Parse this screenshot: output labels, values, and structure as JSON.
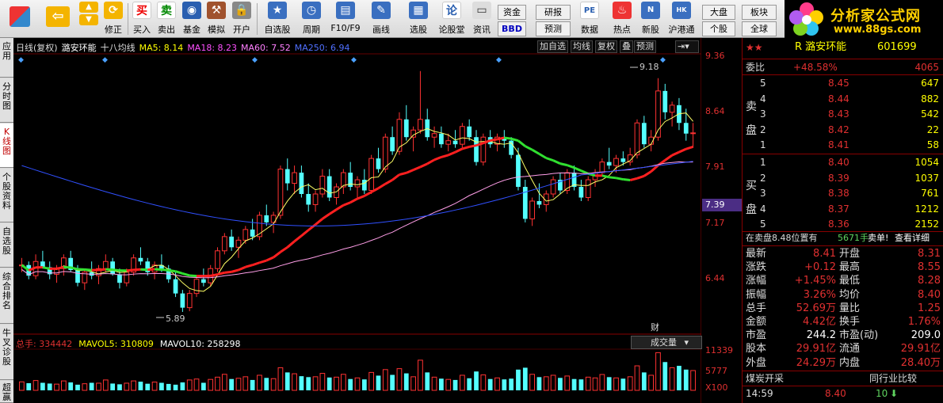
{
  "toolbar": {
    "buttons": [
      {
        "label": "买入",
        "icon": "buy-icon"
      },
      {
        "label": "卖出",
        "icon": "sell-icon"
      },
      {
        "label": "基金",
        "icon": "fund-icon"
      },
      {
        "label": "模拟",
        "icon": "hammer-icon"
      },
      {
        "label": "开户",
        "icon": "lock-icon"
      },
      {
        "label": "自选股",
        "icon": "star-icon"
      },
      {
        "label": "周期",
        "icon": "clock-icon"
      },
      {
        "label": "F10/F9",
        "icon": "f10-icon"
      },
      {
        "label": "画线",
        "icon": "pen-icon"
      },
      {
        "label": "选股",
        "icon": "screen-icon"
      },
      {
        "label": "论股堂",
        "icon": "forum-icon"
      },
      {
        "label": "资讯",
        "icon": "news-icon"
      },
      {
        "label": "数据",
        "icon": "pe-icon"
      },
      {
        "label": "热点",
        "icon": "hot-icon"
      },
      {
        "label": "新股",
        "icon": "newstock-icon"
      },
      {
        "label": "沪港通",
        "icon": "hk-icon"
      }
    ],
    "nav_prev": "修正",
    "small_buttons": {
      "fund": "资金",
      "bbd": "BBD",
      "research": "研报",
      "forecast": "预测",
      "market": "大盘",
      "stock": "个股",
      "sector": "板块",
      "global": "全球"
    }
  },
  "logo": {
    "title": "分析家公式网",
    "url": "www.88gs.com"
  },
  "left_tabs": [
    "应用",
    "分时图",
    "K线图",
    "个股资料",
    "自选股",
    "综合排名",
    "牛叉诊股",
    "超赢"
  ],
  "chart_header": {
    "period": "日线(复权)",
    "stock_name": "潞安环能",
    "indicator": "十八均线",
    "ma5": "MA5: 8.14",
    "ma18": "MA18: 8.23",
    "ma60": "MA60: 7.52",
    "ma250": "MA250: 6.94",
    "buttons": [
      "加自选",
      "均线",
      "复权",
      "叠",
      "预测"
    ]
  },
  "price_axis": [
    "9.36",
    "8.64",
    "7.91",
    "7.17",
    "6.44"
  ],
  "price_highlight": "7.39",
  "annotations": {
    "high": "9.18",
    "low": "5.89",
    "cai": "财"
  },
  "volume": {
    "header_total": "总手: 334442",
    "mavol5": "MAVOL5: 310809",
    "mavol10": "MAVOL10: 258298",
    "selector": "成交量",
    "axis": [
      "11339",
      "5777",
      "X100"
    ]
  },
  "chart_data": {
    "type": "candlestick",
    "ylim": [
      5.6,
      9.5
    ],
    "candles": [
      [
        6.55,
        6.65,
        6.45,
        6.55
      ],
      [
        6.55,
        6.6,
        6.35,
        6.4
      ],
      [
        6.4,
        6.7,
        6.35,
        6.6
      ],
      [
        6.6,
        6.75,
        6.5,
        6.52
      ],
      [
        6.52,
        6.6,
        6.35,
        6.42
      ],
      [
        6.42,
        6.55,
        6.3,
        6.5
      ],
      [
        6.5,
        6.7,
        6.4,
        6.65
      ],
      [
        6.65,
        6.75,
        6.45,
        6.48
      ],
      [
        6.48,
        6.55,
        6.25,
        6.3
      ],
      [
        6.3,
        6.5,
        6.2,
        6.45
      ],
      [
        6.45,
        6.6,
        6.35,
        6.4
      ],
      [
        6.4,
        6.55,
        6.28,
        6.5
      ],
      [
        6.5,
        6.7,
        6.45,
        6.6
      ],
      [
        6.6,
        6.65,
        6.4,
        6.42
      ],
      [
        6.42,
        6.5,
        6.22,
        6.3
      ],
      [
        6.3,
        6.5,
        6.25,
        6.45
      ],
      [
        6.45,
        6.7,
        6.4,
        6.65
      ],
      [
        6.65,
        6.8,
        6.55,
        6.6
      ],
      [
        6.6,
        6.65,
        6.4,
        6.45
      ],
      [
        6.45,
        6.6,
        6.35,
        6.55
      ],
      [
        6.55,
        6.7,
        6.45,
        6.5
      ],
      [
        6.5,
        6.55,
        6.3,
        6.35
      ],
      [
        6.35,
        6.45,
        6.1,
        6.15
      ],
      [
        6.15,
        6.2,
        5.89,
        5.95
      ],
      [
        5.95,
        6.2,
        5.9,
        6.15
      ],
      [
        6.15,
        6.4,
        6.1,
        6.35
      ],
      [
        6.35,
        6.5,
        6.25,
        6.3
      ],
      [
        6.3,
        6.55,
        6.25,
        6.5
      ],
      [
        6.5,
        6.8,
        6.45,
        6.75
      ],
      [
        6.75,
        7.0,
        6.7,
        6.95
      ],
      [
        6.95,
        7.05,
        6.75,
        6.8
      ],
      [
        6.8,
        6.95,
        6.65,
        6.9
      ],
      [
        6.9,
        7.1,
        6.85,
        7.05
      ],
      [
        7.05,
        7.2,
        6.9,
        6.95
      ],
      [
        6.95,
        7.3,
        6.9,
        7.25
      ],
      [
        7.25,
        7.4,
        7.1,
        7.15
      ],
      [
        7.15,
        7.3,
        7.0,
        7.25
      ],
      [
        7.25,
        7.95,
        7.2,
        7.9
      ],
      [
        7.9,
        8.05,
        7.6,
        7.7
      ],
      [
        7.7,
        7.95,
        7.55,
        7.85
      ],
      [
        7.85,
        7.95,
        7.5,
        7.55
      ],
      [
        7.55,
        7.7,
        7.3,
        7.4
      ],
      [
        7.4,
        7.6,
        7.3,
        7.55
      ],
      [
        7.55,
        7.9,
        7.5,
        7.8
      ],
      [
        7.8,
        7.9,
        7.45,
        7.5
      ],
      [
        7.5,
        7.7,
        7.4,
        7.65
      ],
      [
        7.65,
        7.9,
        7.55,
        7.85
      ],
      [
        7.85,
        8.0,
        7.6,
        7.65
      ],
      [
        7.65,
        7.8,
        7.5,
        7.75
      ],
      [
        7.75,
        7.9,
        7.55,
        7.6
      ],
      [
        7.6,
        8.1,
        7.55,
        8.05
      ],
      [
        8.05,
        8.2,
        7.85,
        7.9
      ],
      [
        7.9,
        8.4,
        7.85,
        8.35
      ],
      [
        8.35,
        8.5,
        8.1,
        8.15
      ],
      [
        8.15,
        8.7,
        8.1,
        8.6
      ],
      [
        8.6,
        8.8,
        8.3,
        8.35
      ],
      [
        8.35,
        8.5,
        8.15,
        8.45
      ],
      [
        8.45,
        9.28,
        8.4,
        8.6
      ],
      [
        8.6,
        8.75,
        8.3,
        8.35
      ],
      [
        8.35,
        8.5,
        8.2,
        8.4
      ],
      [
        8.4,
        8.5,
        8.2,
        8.25
      ],
      [
        8.25,
        8.4,
        8.15,
        8.3
      ],
      [
        8.3,
        8.45,
        8.2,
        8.25
      ],
      [
        8.25,
        8.55,
        8.2,
        8.5
      ],
      [
        8.5,
        8.6,
        8.3,
        8.35
      ],
      [
        8.35,
        8.45,
        7.95,
        8.0
      ],
      [
        8.0,
        8.4,
        7.95,
        8.35
      ],
      [
        8.35,
        8.45,
        8.2,
        8.25
      ],
      [
        8.25,
        8.4,
        8.15,
        8.35
      ],
      [
        8.35,
        8.45,
        8.2,
        8.3
      ],
      [
        8.3,
        8.35,
        8.05,
        8.1
      ],
      [
        8.1,
        8.2,
        7.6,
        7.65
      ],
      [
        7.65,
        7.75,
        7.15,
        7.2
      ],
      [
        7.2,
        7.5,
        7.1,
        7.45
      ],
      [
        7.45,
        7.7,
        7.35,
        7.4
      ],
      [
        7.4,
        7.6,
        7.3,
        7.55
      ],
      [
        7.55,
        7.8,
        7.5,
        7.75
      ],
      [
        7.75,
        7.85,
        7.55,
        7.6
      ],
      [
        7.6,
        7.9,
        7.55,
        7.85
      ],
      [
        7.85,
        7.95,
        7.6,
        7.65
      ],
      [
        7.65,
        7.75,
        7.45,
        7.5
      ],
      [
        7.5,
        7.8,
        7.45,
        7.75
      ],
      [
        7.75,
        7.9,
        7.65,
        7.85
      ],
      [
        7.85,
        8.05,
        7.8,
        8.0
      ],
      [
        8.0,
        8.2,
        7.9,
        7.95
      ],
      [
        7.95,
        8.1,
        7.85,
        8.05
      ],
      [
        8.05,
        8.15,
        7.95,
        8.0
      ],
      [
        8.0,
        8.2,
        7.95,
        8.1
      ],
      [
        8.1,
        8.6,
        8.05,
        8.55
      ],
      [
        8.55,
        8.65,
        8.2,
        8.25
      ],
      [
        8.25,
        8.45,
        8.15,
        8.35
      ],
      [
        8.35,
        9.18,
        8.3,
        9.0
      ],
      [
        9.0,
        9.1,
        8.6,
        8.7
      ],
      [
        8.7,
        8.85,
        8.5,
        8.8
      ],
      [
        8.8,
        8.9,
        8.45,
        8.55
      ],
      [
        8.55,
        8.75,
        8.3,
        8.4
      ],
      [
        8.4,
        8.55,
        8.2,
        8.41
      ]
    ],
    "volume": [
      45,
      38,
      52,
      40,
      36,
      33,
      50,
      42,
      30,
      35,
      40,
      38,
      55,
      36,
      32,
      38,
      50,
      46,
      35,
      44,
      40,
      34,
      30,
      42,
      55,
      60,
      40,
      58,
      70,
      85,
      60,
      64,
      72,
      55,
      80,
      66,
      62,
      120,
      95,
      88,
      75,
      70,
      72,
      90,
      68,
      70,
      85,
      60,
      66,
      58,
      95,
      78,
      110,
      82,
      115,
      90,
      72,
      160,
      95,
      70,
      62,
      58,
      55,
      80,
      64,
      100,
      82,
      60,
      66,
      58,
      62,
      110,
      120,
      85,
      70,
      72,
      80,
      66,
      76,
      60,
      58,
      70,
      66,
      84,
      70,
      66,
      62,
      72,
      130,
      95,
      80,
      200,
      150,
      120,
      130,
      110,
      105
    ]
  },
  "quote": {
    "stars": "★★",
    "name": "R 潞安环能",
    "code": "601699",
    "weibi_label": "委比",
    "weibi": "+48.58%",
    "weicha": "4065",
    "sell_label": "卖盘",
    "buy_label": "买盘",
    "asks": [
      [
        "5",
        "8.45",
        "647"
      ],
      [
        "4",
        "8.44",
        "882"
      ],
      [
        "3",
        "8.43",
        "542"
      ],
      [
        "2",
        "8.42",
        "22"
      ],
      [
        "1",
        "8.41",
        "58"
      ]
    ],
    "bids": [
      [
        "1",
        "8.40",
        "1054"
      ],
      [
        "2",
        "8.39",
        "1037"
      ],
      [
        "3",
        "8.38",
        "761"
      ],
      [
        "4",
        "8.37",
        "1212"
      ],
      [
        "5",
        "8.36",
        "2152"
      ]
    ],
    "notice": "在卖盘8.48位置有",
    "notice_vol": "5671手",
    "notice_tag": "卖单!",
    "notice_link": "查看详细",
    "stats": [
      [
        "最新",
        "8.41",
        "开盘",
        "8.31"
      ],
      [
        "涨跌",
        "+0.12",
        "最高",
        "8.55"
      ],
      [
        "涨幅",
        "+1.45%",
        "最低",
        "8.28"
      ],
      [
        "振幅",
        "3.26%",
        "均价",
        "8.40"
      ],
      [
        "总手",
        "52.69万",
        "量比",
        "1.25"
      ],
      [
        "金额",
        "4.42亿",
        "换手",
        "1.76%"
      ],
      [
        "市盈",
        "244.2",
        "市盈(动)",
        "209.0"
      ],
      [
        "股本",
        "29.91亿",
        "流通",
        "29.91亿"
      ],
      [
        "外盘",
        "24.29万",
        "内盘",
        "28.40万"
      ]
    ],
    "industry": "煤炭开采",
    "industry_compare": "同行业比较",
    "tick": {
      "time": "14:59",
      "price": "8.40",
      "vol": "10"
    }
  }
}
